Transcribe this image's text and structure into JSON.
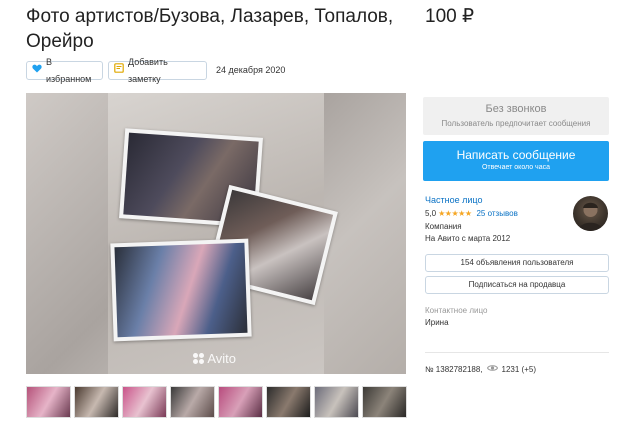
{
  "listing": {
    "title": "Фото артистов/Бузова, Лазарев, Топалов, Орейро",
    "price": "100 ₽",
    "favorite_label": "В избранном",
    "note_label": "Добавить заметку",
    "date": "24 декабря 2020"
  },
  "gallery": {
    "watermark": "Avito",
    "thumbnail_count": 8
  },
  "contact_panel": {
    "calls_title": "Без звонков",
    "calls_subtitle": "Пользователь предпочитает сообщения",
    "message_button": "Написать сообщение",
    "message_subtitle": "Отвечает около часа",
    "seller_type": "Частное лицо",
    "rating": "5,0",
    "stars": "★★★★★",
    "reviews": "25 отзывов",
    "seller_kind": "Компания",
    "since": "На Авито с марта 2012",
    "ads_button": "154 объявления пользователя",
    "subscribe_button": "Подписаться на продавца",
    "contact_label": "Контактное лицо",
    "contact_name": "Ирина"
  },
  "meta": {
    "ad_number": "№ 1382782188,",
    "views": "1231 (+5)"
  },
  "colors": {
    "accent": "#1fa1f0",
    "link": "#0a72c5",
    "star": "#f5a623"
  }
}
